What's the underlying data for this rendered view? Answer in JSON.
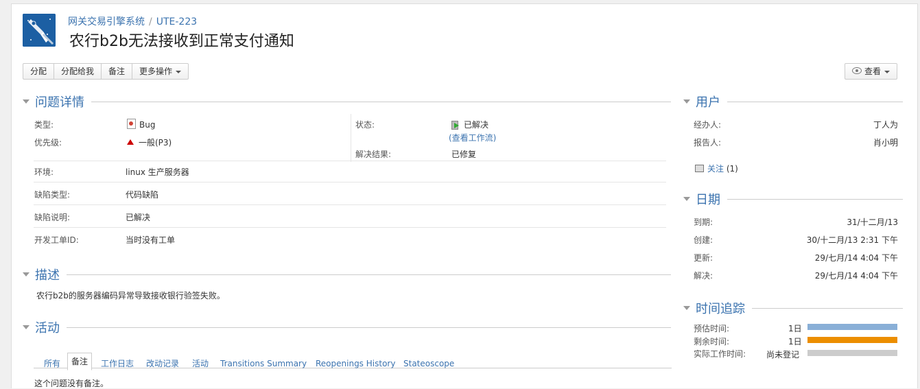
{
  "breadcrumb": {
    "project": "网关交易引擎系统",
    "separator": "/",
    "issue_key": "UTE-223"
  },
  "issue_title": "农行b2b无法接收到正常支付通知",
  "toolbar": {
    "assign": "分配",
    "assign_to_me": "分配给我",
    "comment": "备注",
    "more_actions": "更多操作",
    "view": "查看"
  },
  "details": {
    "heading": "问题详情",
    "type_label": "类型:",
    "type_value": "Bug",
    "priority_label": "优先级:",
    "priority_value": "一般(P3)",
    "status_label": "状态:",
    "status_value": "已解决",
    "view_workflow": "(查看工作流)",
    "resolution_label": "解决结果:",
    "resolution_value": "已修复",
    "env_label": "环境:",
    "env_value": "linux 生产服务器",
    "defect_type_label": "缺陷类型:",
    "defect_type_value": "代码缺陷",
    "defect_desc_label": "缺陷说明:",
    "defect_desc_value": "已解决",
    "work_order_label": "开发工单ID:",
    "work_order_value": "当时没有工单"
  },
  "description": {
    "heading": "描述",
    "text": "农行b2b的服务器编码异常导致接收银行验签失败。"
  },
  "activity": {
    "heading": "活动",
    "tabs": [
      "所有",
      "备注",
      "工作日志",
      "改动记录",
      "活动",
      "Transitions Summary",
      "Reopenings History",
      "Stateoscope"
    ],
    "active_tab": "备注",
    "empty_text": "这个问题没有备注。"
  },
  "people": {
    "heading": "用户",
    "assignee_label": "经办人:",
    "assignee_value": "丁人为",
    "reporter_label": "报告人:",
    "reporter_value": "肖小明",
    "watch_label": "关注",
    "watch_count": "(1)"
  },
  "dates": {
    "heading": "日期",
    "due_label": "到期:",
    "due_value": "31/十二月/13",
    "created_label": "创建:",
    "created_value": "30/十二月/13 2:31 下午",
    "updated_label": "更新:",
    "updated_value": "29/七月/14 4:04 下午",
    "resolved_label": "解决:",
    "resolved_value": "29/七月/14 4:04 下午"
  },
  "time_tracking": {
    "heading": "时间追踪",
    "estimated_label": "预估时间:",
    "estimated_value": "1日",
    "estimated_fill": 1.0,
    "remaining_label": "剩余时间:",
    "remaining_value": "1日",
    "remaining_fill": 1.0,
    "logged_label": "实际工作时间:",
    "logged_value": "尚未登记",
    "logged_fill": 0.0
  },
  "colors": {
    "link": "#3b73af",
    "estimated_bar": "#89afd7",
    "remaining_bar": "#ec8e00",
    "logged_bar": "#cccccc"
  }
}
